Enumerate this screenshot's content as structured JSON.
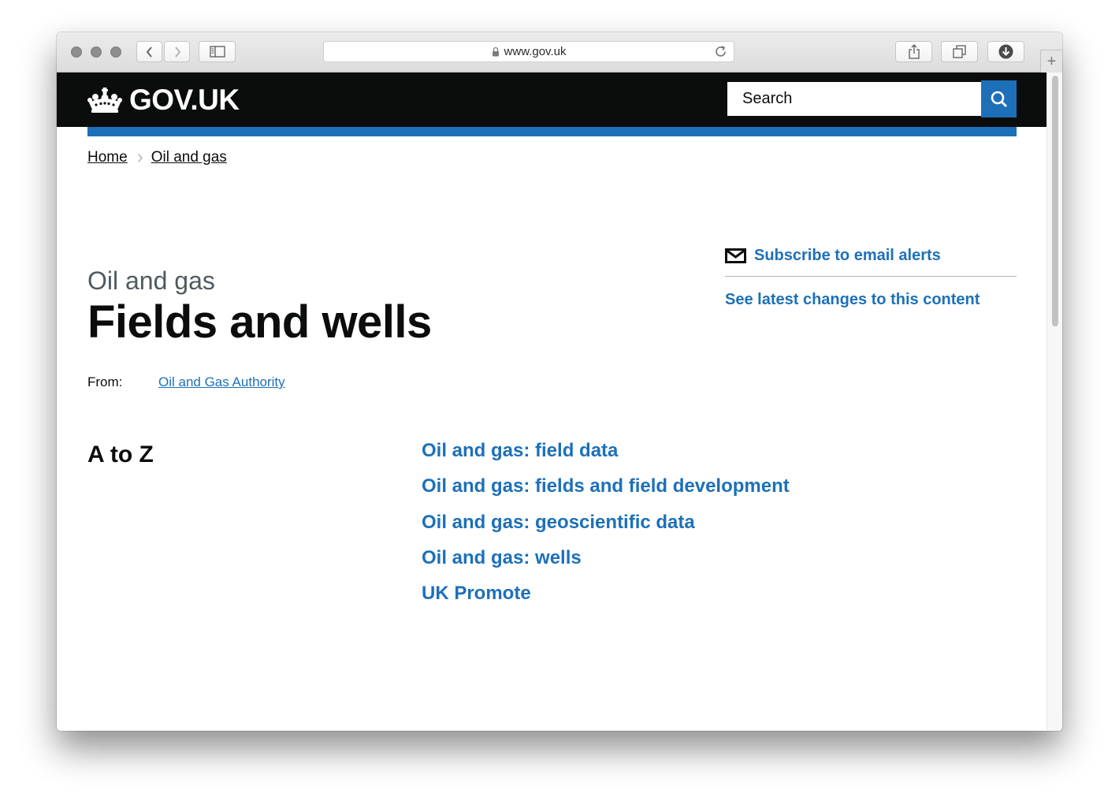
{
  "browser": {
    "url": "www.gov.uk",
    "icons": [
      "back-arrow-icon",
      "forward-arrow-icon",
      "sidebar-icon",
      "lock-icon",
      "reload-icon",
      "share-icon",
      "tabs-icon",
      "download-icon",
      "plus-icon"
    ]
  },
  "header": {
    "logo_text": "GOV.UK",
    "search_placeholder": "Search"
  },
  "breadcrumb": {
    "items": [
      {
        "label": "Home"
      },
      {
        "label": "Oil and gas"
      }
    ]
  },
  "main": {
    "caption": "Oil and gas",
    "title": "Fields and wells",
    "from_label": "From:",
    "from_org": "Oil and Gas Authority"
  },
  "sidebar": {
    "subscribe_label": "Subscribe to email alerts",
    "latest_changes_label": "See latest changes to this content"
  },
  "atoz": {
    "heading": "A to Z",
    "links": [
      {
        "label": "Oil and gas: field data"
      },
      {
        "label": "Oil and gas: fields and field development"
      },
      {
        "label": "Oil and gas: geoscientific data"
      },
      {
        "label": "Oil and gas: wells"
      },
      {
        "label": "UK Promote"
      }
    ]
  },
  "colors": {
    "header_bg": "#0b0c0c",
    "link_blue": "#1d70b8",
    "secondary_text": "#505a5f"
  }
}
